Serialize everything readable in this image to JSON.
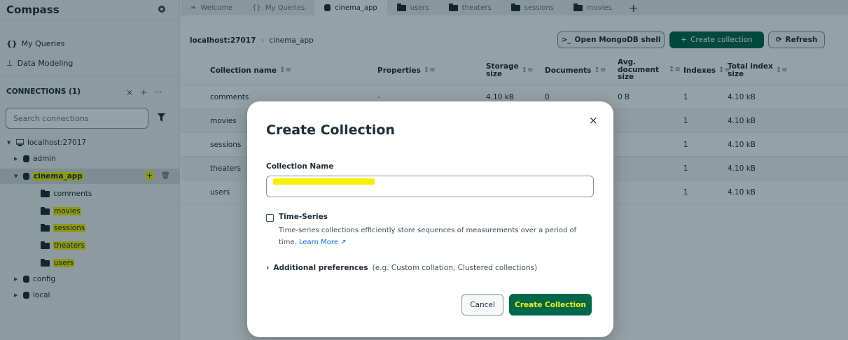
{
  "sidebar": {
    "app_title": "Compass",
    "my_queries": "My Queries",
    "data_modeling": "Data Modeling",
    "connections_label": "CONNECTIONS (1)",
    "search_placeholder": "Search connections",
    "tree": {
      "host": "localhost:27017",
      "databases": [
        {
          "name": "admin"
        },
        {
          "name": "cinema_app",
          "collections": [
            "comments",
            "movies",
            "sessions",
            "theaters",
            "users"
          ]
        },
        {
          "name": "config"
        },
        {
          "name": "local"
        }
      ]
    }
  },
  "tabs": [
    {
      "label": "Welcome",
      "icon": "leaf-icon"
    },
    {
      "label": "My Queries",
      "icon": "braces-icon"
    },
    {
      "label": "cinema_app",
      "icon": "database-icon"
    },
    {
      "label": "users",
      "icon": "folder-icon"
    },
    {
      "label": "theaters",
      "icon": "folder-icon"
    },
    {
      "label": "sessions",
      "icon": "folder-icon"
    },
    {
      "label": "movies",
      "icon": "folder-icon"
    }
  ],
  "toolbar": {
    "host": "localhost:27017",
    "database": "cinema_app",
    "open_shell": "Open MongoDB shell",
    "create_collection": "Create collection",
    "refresh": "Refresh"
  },
  "table": {
    "headers": {
      "name": "Collection name",
      "properties": "Properties",
      "storage_a": "Storage",
      "storage_b": "size",
      "documents": "Documents",
      "avg_a": "Avg.",
      "avg_b": "document",
      "avg_c": "size",
      "indexes": "Indexes",
      "total_a": "Total index",
      "total_b": "size"
    },
    "rows": [
      {
        "name": "comments",
        "properties": "-",
        "storage": "4.10 kB",
        "documents": "0",
        "avg": "0 B",
        "indexes": "1",
        "total": "4.10 kB"
      },
      {
        "name": "movies",
        "properties": "",
        "storage": "",
        "documents": "",
        "avg": "",
        "indexes": "1",
        "total": "4.10 kB"
      },
      {
        "name": "sessions",
        "properties": "",
        "storage": "",
        "documents": "",
        "avg": "",
        "indexes": "1",
        "total": "4.10 kB"
      },
      {
        "name": "theaters",
        "properties": "",
        "storage": "",
        "documents": "",
        "avg": "",
        "indexes": "1",
        "total": "4.10 kB"
      },
      {
        "name": "users",
        "properties": "",
        "storage": "",
        "documents": "",
        "avg": "",
        "indexes": "1",
        "total": "4.10 kB"
      }
    ]
  },
  "modal": {
    "title": "Create Collection",
    "close": "×",
    "collection_name_label": "Collection Name",
    "timeseries_label": "Time-Series",
    "timeseries_desc": "Time-series collections efficiently store sequences of measurements over a period of time.",
    "learn_more": "Learn More",
    "additional_label": "Additional preferences",
    "additional_hint": "(e.g. Custom collation, Clustered collections)",
    "cancel": "Cancel",
    "create": "Create Collection"
  },
  "colors": {
    "accent_green": "#00684a",
    "highlight": "#f6f000",
    "link_blue": "#016bf8"
  }
}
